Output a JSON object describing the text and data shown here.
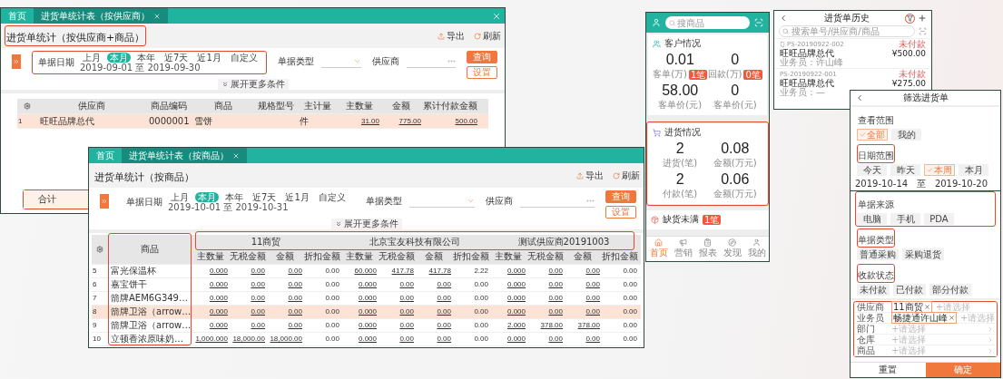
{
  "report_supplier": {
    "tabs": [
      {
        "label": "首页",
        "selected": false,
        "closable": false
      },
      {
        "label": "进货单统计表（按供应商）",
        "selected": true,
        "closable": true
      }
    ],
    "window_closable": true,
    "title": "进货单统计（按供应商+商品）",
    "title_highlighted": true,
    "actions": [
      {
        "kind": "export",
        "label": "导出"
      },
      {
        "kind": "refresh",
        "label": "刷新"
      }
    ],
    "date_filter": {
      "label": "单据日期",
      "highlighted": true,
      "options": [
        {
          "label": "上月",
          "selected": false
        },
        {
          "label": "本月",
          "selected": true
        },
        {
          "label": "本年",
          "selected": false
        },
        {
          "label": "近7天",
          "selected": false
        },
        {
          "label": "近1月",
          "selected": false
        },
        {
          "label": "自定义",
          "selected": false
        }
      ],
      "range": "2019-09-01 至 2019-09-30"
    },
    "fields": [
      {
        "kind": "select",
        "label": "单据类型"
      },
      {
        "kind": "lookup",
        "label": "供应商"
      }
    ],
    "buttons": [
      {
        "kind": "primary",
        "label": "查询"
      },
      {
        "kind": "secondary",
        "label": "设置"
      }
    ],
    "expand": "展开更多条件",
    "table": {
      "columns": [
        {
          "label": "供应商",
          "kind": "text"
        },
        {
          "label": "商品编码",
          "kind": "text"
        },
        {
          "label": "商品",
          "kind": "text"
        },
        {
          "label": "规格型号",
          "kind": "text"
        },
        {
          "label": "主计量",
          "kind": "text"
        },
        {
          "label": "主数量",
          "kind": "link"
        },
        {
          "label": "金额",
          "kind": "link"
        },
        {
          "label": "累计付款金额",
          "kind": "link"
        }
      ],
      "rows": [
        {
          "index": "1",
          "cells": [
            "旺旺品牌总代",
            "0000001",
            "雪饼",
            null,
            "件",
            "31.00",
            "775.00",
            "500.00"
          ],
          "selected": true
        }
      ]
    },
    "total": {
      "label": "合计",
      "highlighted": true
    }
  },
  "report_product": {
    "tabs": [
      {
        "label": "首页",
        "selected": false,
        "closable": false
      },
      {
        "label": "进货单统计表（按商品）",
        "selected": true,
        "closable": true
      }
    ],
    "window_closable": false,
    "title": "进货单统计（按商品）",
    "title_highlighted": false,
    "actions": [
      {
        "kind": "export",
        "label": "导出"
      },
      {
        "kind": "refresh",
        "label": "刷新"
      }
    ],
    "date_filter": {
      "label": "单据日期",
      "highlighted": false,
      "options": [
        {
          "label": "上月",
          "selected": false
        },
        {
          "label": "本月",
          "selected": true
        },
        {
          "label": "本年",
          "selected": false
        },
        {
          "label": "近7天",
          "selected": false
        },
        {
          "label": "近1月",
          "selected": false
        },
        {
          "label": "自定义",
          "selected": false
        }
      ],
      "range": "2019-10-01 至 2019-10-31"
    },
    "fields": [
      {
        "kind": "select",
        "label": "单据类型"
      },
      {
        "kind": "lookup",
        "label": "供应商"
      }
    ],
    "buttons": [
      {
        "kind": "primary",
        "label": "查询"
      },
      {
        "kind": "secondary",
        "label": "设置"
      }
    ],
    "expand": "展开更多条件",
    "table": {
      "product_column": {
        "label": "商品",
        "highlighted": true
      },
      "groups_highlighted": true,
      "groups": [
        {
          "label": "11商贸",
          "columns": [
            "主数量",
            "无税金额",
            "金额",
            "折扣金额"
          ]
        },
        {
          "label": "北京宝友科技有限公司",
          "columns": [
            "主数量",
            "无税金额",
            "金额",
            "折扣金额"
          ]
        },
        {
          "label": "测试供应商20191003",
          "columns": [
            "主数量",
            "无税金额",
            "金额",
            "折扣金额"
          ]
        }
      ],
      "rows": [
        {
          "index": "5",
          "product": "富光保温杯",
          "selected": false,
          "values": [
            "0.000",
            "0.00",
            "0.00",
            "0.00",
            "60.000",
            "417.78",
            "417.78",
            "2.22",
            "0.000",
            "0.00",
            "0.00",
            "0.00"
          ]
        },
        {
          "index": "6",
          "product": "嘉宝饼干",
          "selected": false,
          "values": [
            "0.000",
            "0.00",
            "0.00",
            "0.00",
            "0.000",
            "0.00",
            "0.00",
            "0.00",
            "0.000",
            "0.00",
            "0.00",
            "0.00"
          ]
        },
        {
          "index": "7",
          "product": "箭牌AEM6G349…",
          "selected": false,
          "values": [
            "0.000",
            "0.00",
            "0.00",
            "0.00",
            "0.000",
            "0.00",
            "0.00",
            "0.00",
            "0.000",
            "0.00",
            "0.00",
            "0.00"
          ]
        },
        {
          "index": "8",
          "product": "箭牌卫浴（arrow…",
          "selected": true,
          "values": [
            "0.000",
            "0.00",
            "0.00",
            "0.00",
            "0.000",
            "0.00",
            "0.00",
            "0.00",
            "0.000",
            "0.00",
            "0.00",
            "0.00"
          ]
        },
        {
          "index": "9",
          "product": "箭牌卫浴（arrow…",
          "selected": false,
          "values": [
            "0.000",
            "0.00",
            "0.00",
            "0.00",
            "0.000",
            "0.00",
            "0.00",
            "0.00",
            "2.000",
            "378.00",
            "378.00",
            "0.00"
          ]
        },
        {
          "index": "10",
          "product": "立顿香浓原味奶…",
          "selected": false,
          "values": [
            "1,000.000",
            "18,000.00",
            "18,000.00",
            "0.00",
            "0.000",
            "0.00",
            "0.00",
            "0.00",
            "0.000",
            "0.00",
            "0.00",
            "0.00"
          ]
        }
      ]
    }
  },
  "dashboard": {
    "search": {
      "placeholder": "搜商品"
    },
    "sections": [
      {
        "title": "客户情况",
        "highlighted": false,
        "stats": [
          {
            "value": "0.01",
            "label": "客单(万)",
            "badge": "1笔"
          },
          {
            "value": "0",
            "label": "回款(万)",
            "badge": "0笔"
          },
          {
            "value": "58.00",
            "label": "客单价(元)"
          },
          {
            "value": "0",
            "label": "客单价(元)"
          }
        ]
      },
      {
        "title": "进货情况",
        "highlighted": true,
        "stats": [
          {
            "value": "2",
            "label": "进货(笔)"
          },
          {
            "value": "0.08",
            "label": "金额(万元)"
          },
          {
            "value": "2",
            "label": "付款(笔)"
          },
          {
            "value": "0.06",
            "label": "金额(万元)"
          }
        ]
      }
    ],
    "alert": {
      "title": "缺货未满",
      "badge": "1笔"
    },
    "nav": [
      {
        "label": "首页",
        "selected": true
      },
      {
        "label": "营销",
        "selected": false
      },
      {
        "label": "报表",
        "selected": false
      },
      {
        "label": "发现",
        "selected": false
      },
      {
        "label": "我的",
        "selected": false
      }
    ]
  },
  "purchase_history": {
    "title": "进货单历史",
    "filter_highlighted": true,
    "search": {
      "placeholder": "搜索单号/供应商/商品"
    },
    "orders": [
      {
        "code": "PS-20190922-002",
        "from_mobile": true,
        "supplier": "旺旺品牌总代",
        "amount": "¥500.00",
        "status": "未付款",
        "salesperson": "业务员：许山峰"
      },
      {
        "code": "PS-20190922-001",
        "from_mobile": false,
        "supplier": "旺旺品牌总代",
        "amount": "¥275.00",
        "status": "未付款",
        "salesperson": "业务员：—"
      }
    ]
  },
  "purchase_filter": {
    "title": "筛选进货单",
    "groups": [
      {
        "title": "查看范围",
        "title_highlighted": false,
        "group_highlighted": false,
        "options": [
          {
            "label": "全部",
            "selected": true
          },
          {
            "label": "我的",
            "selected": false
          }
        ]
      },
      {
        "title": "日期范围",
        "title_highlighted": true,
        "group_highlighted": false,
        "options": [
          {
            "label": "今天",
            "selected": false
          },
          {
            "label": "昨天",
            "selected": false
          },
          {
            "label": "本周",
            "selected": true
          },
          {
            "label": "本月",
            "selected": false
          }
        ],
        "dates": {
          "start": "2019-10-14",
          "separator": "至",
          "end": "2019-10-20"
        }
      },
      {
        "title": "单据来源",
        "title_highlighted": false,
        "group_highlighted": true,
        "options": [
          {
            "label": "电脑",
            "selected": false
          },
          {
            "label": "手机",
            "selected": false
          },
          {
            "label": "PDA",
            "selected": false
          }
        ]
      },
      {
        "title": "单据类型",
        "title_highlighted": true,
        "group_highlighted": false,
        "options": [
          {
            "label": "普通采购",
            "selected": false
          },
          {
            "label": "采购退货",
            "selected": false
          }
        ]
      },
      {
        "title": "收款状态",
        "title_highlighted": true,
        "group_highlighted": false,
        "options": [
          {
            "label": "未付款",
            "selected": false
          },
          {
            "label": "已付款",
            "selected": false
          },
          {
            "label": "部分付款",
            "selected": false
          }
        ]
      }
    ],
    "fields_highlighted": true,
    "fields": [
      {
        "label": "供应商",
        "tags": [
          "11商贸"
        ],
        "placeholder": "+请选择",
        "arrow": false
      },
      {
        "label": "业务员",
        "tags": [
          "畅捷通许山峰"
        ],
        "placeholder": "+请选择",
        "arrow": false
      },
      {
        "label": "部门",
        "placeholder": "+请选择",
        "arrow": true
      },
      {
        "label": "仓库",
        "placeholder": "+请选择",
        "arrow": true
      },
      {
        "label": "商品",
        "placeholder": "+请选择",
        "arrow": true
      }
    ],
    "buttons": [
      {
        "kind": "secondary",
        "label": "重置"
      },
      {
        "kind": "primary",
        "label": "确定"
      }
    ]
  }
}
